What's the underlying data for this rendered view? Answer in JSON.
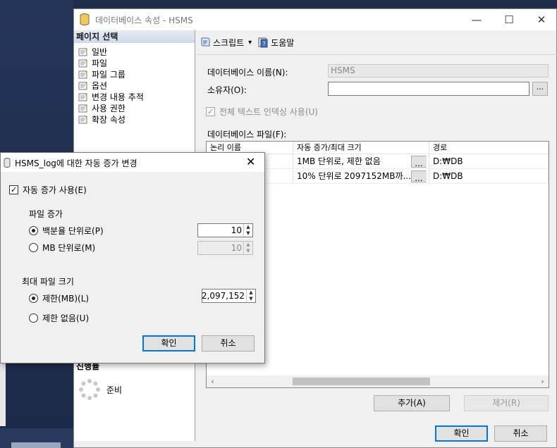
{
  "main_window": {
    "title": "데이터베이스 속성 - HSMS",
    "controls": {
      "minimize": "—",
      "maximize": "☐",
      "close": "✕"
    },
    "left_pane": {
      "header": "페이지 선택",
      "pages": [
        "일반",
        "파일",
        "파일 그룹",
        "옵션",
        "변경 내용 추적",
        "사용 권한",
        "확장 속성"
      ],
      "progress_header": "진행률",
      "progress_status": "준비"
    },
    "toolbar": {
      "script_label": "스크립트",
      "dropdown": "▾",
      "help_label": "도움말"
    },
    "form": {
      "db_name_label": "데이터베이스 이름(N):",
      "db_name_value": "HSMS",
      "owner_label": "소유자(O):",
      "owner_value": "",
      "ellipsis": "...",
      "fulltext_label": "전체 텍스트 인덱싱 사용(U)",
      "files_label": "데이터베이스 파일(F):"
    },
    "grid": {
      "columns": [
        "논리 이름",
        "자동 증가/최대 크기",
        "경로"
      ],
      "rows": [
        {
          "logical": "",
          "growth": "1MB 단위로, 제한 없음",
          "path": "D:₩DB"
        },
        {
          "logical": "",
          "growth": "10% 단위로 2097152MB까...",
          "path": "D:₩DB"
        }
      ],
      "scroll_left": "‹",
      "scroll_right": "›"
    },
    "buttons": {
      "add": "추가(A)",
      "remove": "제거(R)",
      "ok": "확인",
      "cancel": "취소"
    }
  },
  "dialog": {
    "title": "HSMS_log에 대한 자동 증가 변경",
    "close": "✕",
    "enable_label": "자동 증가 사용(E)",
    "enable_checked": true,
    "growth_group": "파일 증가",
    "percent_label": "백분율 단위로(P)",
    "percent_value": "10",
    "mb_label": "MB 단위로(M)",
    "mb_value": "10",
    "growth_mode": "percent",
    "max_group": "최대 파일 크기",
    "limited_label": "제한(MB)(L)",
    "limited_value": "2,097,152",
    "unlimited_label": "제한 없음(U)",
    "max_mode": "limited",
    "spin_up": "▲",
    "spin_down": "▼",
    "ok": "확인",
    "cancel": "취소"
  }
}
